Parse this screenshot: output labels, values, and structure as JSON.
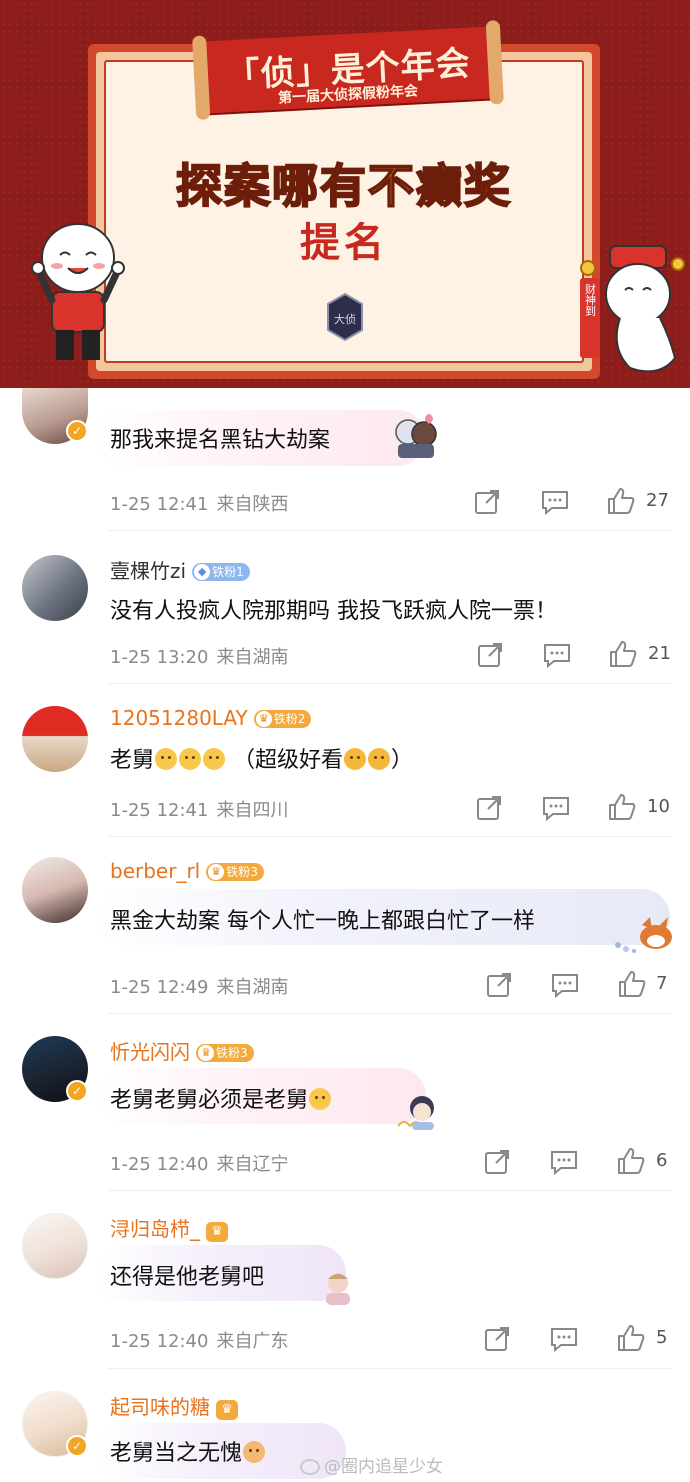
{
  "banner": {
    "ribbon_title": "「侦」是个年会",
    "ribbon_subtitle": "第一届大侦探假粉年会",
    "title": "探案哪有不癫奖",
    "nominate": "提名",
    "scroll_text": "财神到",
    "colors": {
      "background": "#8d1d1a",
      "frame": "#d24a2c",
      "title_gold": "#f6c548",
      "nominate_red": "#c9281e"
    }
  },
  "comments": [
    {
      "username": "",
      "fan_badge": "",
      "text": "那我来提名黑钻大劫案",
      "time": "1-25 12:41",
      "location": "来自陕西",
      "likes": "27",
      "verified": true
    },
    {
      "username": "壹棵竹zi",
      "fan_badge": "铁粉1",
      "text": "没有人投疯人院那期吗 我投飞跃疯人院一票！",
      "time": "1-25 13:20",
      "location": "来自湖南",
      "likes": "21",
      "verified": false
    },
    {
      "username": "12051280LAY",
      "fan_badge": "铁粉2",
      "text": "老舅",
      "text_suffix": "（超级好看",
      "text_end": "）",
      "time": "1-25 12:41",
      "location": "来自四川",
      "likes": "10",
      "verified": false
    },
    {
      "username": "berber_rl",
      "fan_badge": "铁粉3",
      "text": "黑金大劫案 每个人忙一晚上都跟白忙了一样",
      "time": "1-25 12:49",
      "location": "来自湖南",
      "likes": "7",
      "verified": false
    },
    {
      "username": "忻光闪闪",
      "fan_badge": "铁粉3",
      "text": "老舅老舅必须是老舅",
      "time": "1-25 12:40",
      "location": "来自辽宁",
      "likes": "6",
      "verified": true
    },
    {
      "username": "浔归岛栉_",
      "fan_badge": "",
      "text": "还得是他老舅吧",
      "time": "1-25 12:40",
      "location": "来自广东",
      "likes": "5",
      "verified": false
    },
    {
      "username": "起司味的糖",
      "fan_badge": "",
      "text": "老舅当之无愧",
      "time": "",
      "location": "",
      "likes": "",
      "verified": true
    }
  ],
  "icons": {
    "share": "share-icon",
    "comment": "comment-icon",
    "like": "like-icon",
    "verified": "verified-badge-icon",
    "crown": "crown-icon"
  },
  "watermark": "@圈内追星少女"
}
